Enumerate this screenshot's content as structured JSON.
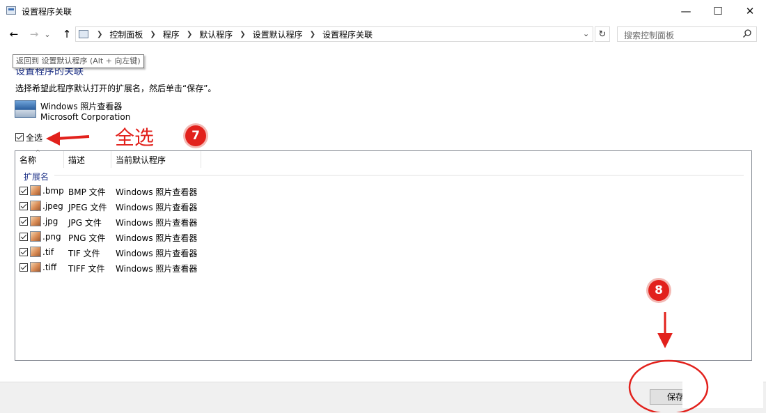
{
  "window": {
    "title": "设置程序关联",
    "minimize_glyph": "—",
    "maximize_glyph": "☐",
    "close_glyph": "✕"
  },
  "nav": {
    "back_glyph": "←",
    "forward_glyph": "→",
    "recent_glyph": "⌄",
    "up_glyph": "↑",
    "breadcrumbs": [
      "控制面板",
      "程序",
      "默认程序",
      "设置默认程序",
      "设置程序关联"
    ],
    "dropdown_glyph": "⌄",
    "refresh_glyph": "↻"
  },
  "search": {
    "placeholder": "搜索控制面板",
    "icon": "search-icon"
  },
  "tooltip": "返回到 设置默认程序 (Alt + 向左键)",
  "page": {
    "heading": "设置程序的关联",
    "instruction": "选择希望此程序默认打开的扩展名，然后单击“保存”。"
  },
  "program": {
    "name": "Windows 照片查看器",
    "publisher": "Microsoft Corporation"
  },
  "select_all": {
    "label": "全选",
    "checked": true
  },
  "list": {
    "columns": [
      "名称",
      "描述",
      "当前默认程序"
    ],
    "group": "扩展名",
    "rows": [
      {
        "ext": ".bmp",
        "desc": "BMP 文件",
        "program": "Windows 照片查看器",
        "checked": true
      },
      {
        "ext": ".jpeg",
        "desc": "JPEG 文件",
        "program": "Windows 照片查看器",
        "checked": true
      },
      {
        "ext": ".jpg",
        "desc": "JPG 文件",
        "program": "Windows 照片查看器",
        "checked": true
      },
      {
        "ext": ".png",
        "desc": "PNG 文件",
        "program": "Windows 照片查看器",
        "checked": true
      },
      {
        "ext": ".tif",
        "desc": "TIF 文件",
        "program": "Windows 照片查看器",
        "checked": true
      },
      {
        "ext": ".tiff",
        "desc": "TIFF 文件",
        "program": "Windows 照片查看器",
        "checked": true
      }
    ]
  },
  "footer": {
    "save_label": "保存"
  },
  "annotations": {
    "label": "全选",
    "step_a": "7",
    "step_b": "8",
    "color": "#e2211c"
  }
}
